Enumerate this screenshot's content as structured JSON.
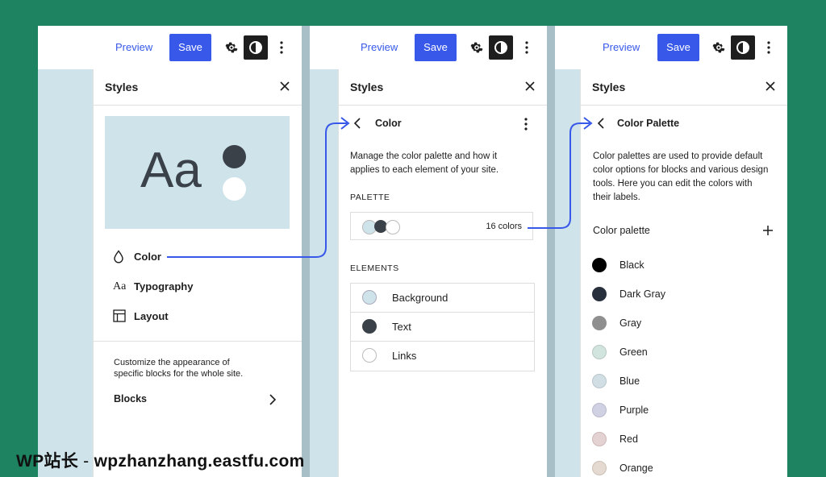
{
  "topbar": {
    "preview_label": "Preview",
    "save_label": "Save"
  },
  "panel1": {
    "title": "Styles",
    "preview_text": "Aa",
    "nav": [
      {
        "label": "Color",
        "icon": "droplet-icon"
      },
      {
        "label": "Typography",
        "icon": "typography-icon",
        "glyph": "Aa"
      },
      {
        "label": "Layout",
        "icon": "layout-icon"
      }
    ],
    "blocks_description": "Customize the appearance of specific blocks for the whole site.",
    "blocks_label": "Blocks"
  },
  "panel2": {
    "title": "Styles",
    "subtitle": "Color",
    "description": "Manage the color palette and how it applies to each element of your site.",
    "palette_heading": "PALETTE",
    "palette_count": "16 colors",
    "elements_heading": "ELEMENTS",
    "elements": [
      {
        "label": "Background",
        "color": "#cfe3ea"
      },
      {
        "label": "Text",
        "color": "#3a4149"
      },
      {
        "label": "Links",
        "color": "#ffffff"
      }
    ]
  },
  "panel3": {
    "title": "Styles",
    "subtitle": "Color Palette",
    "description": "Color palettes are used to provide default color options for blocks and various design tools. Here you can edit the colors with their labels.",
    "palette_label": "Color palette",
    "colors": [
      {
        "label": "Black",
        "color": "#000000"
      },
      {
        "label": "Dark Gray",
        "color": "#28303d"
      },
      {
        "label": "Gray",
        "color": "#8f8f8f"
      },
      {
        "label": "Green",
        "color": "#d1e4dd"
      },
      {
        "label": "Blue",
        "color": "#d1dfe4"
      },
      {
        "label": "Purple",
        "color": "#d1d1e4"
      },
      {
        "label": "Red",
        "color": "#e4d1d1"
      },
      {
        "label": "Orange",
        "color": "#e4dad1"
      }
    ]
  },
  "colors": {
    "accent": "#3858e9",
    "canvas": "#cfe3ea",
    "background": "#1e8361"
  },
  "watermark": {
    "brand": "WP站长",
    "separator": " - ",
    "url": "wpzhanzhang.eastfu.com"
  }
}
